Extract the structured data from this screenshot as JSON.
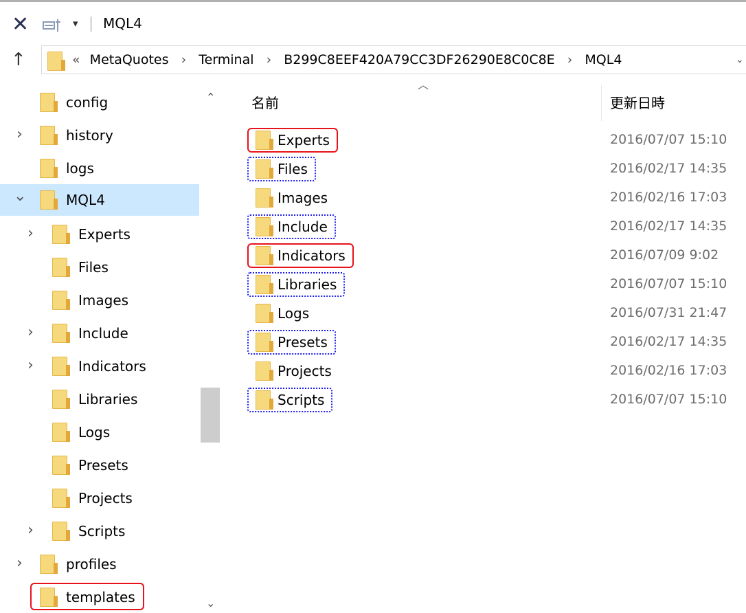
{
  "title_bar": {
    "close_glyph": "✕",
    "properties_icon": "properties-icon",
    "dropdown_glyph": "▾",
    "title": "MQL4"
  },
  "address_bar": {
    "up_glyph": "↑",
    "overflow": "«",
    "separator": "›",
    "crumbs": [
      "MetaQuotes",
      "Terminal",
      "B299C8EEF420A79CC3DF26290E8C0C8E",
      "MQL4"
    ],
    "dropdown_glyph": "⌄"
  },
  "nav_pane": {
    "items": [
      {
        "label": "config",
        "expander": ""
      },
      {
        "label": "history",
        "expander": "›"
      },
      {
        "label": "logs",
        "expander": ""
      },
      {
        "label": "MQL4",
        "expander": "⌄"
      },
      {
        "label": "Experts",
        "expander": "›"
      },
      {
        "label": "Files",
        "expander": ""
      },
      {
        "label": "Images",
        "expander": ""
      },
      {
        "label": "Include",
        "expander": "›"
      },
      {
        "label": "Indicators",
        "expander": "›"
      },
      {
        "label": "Libraries",
        "expander": ""
      },
      {
        "label": "Logs",
        "expander": ""
      },
      {
        "label": "Presets",
        "expander": ""
      },
      {
        "label": "Projects",
        "expander": ""
      },
      {
        "label": "Scripts",
        "expander": "›"
      },
      {
        "label": "profiles",
        "expander": "›"
      },
      {
        "label": "templates",
        "expander": ""
      }
    ],
    "scroll_up": "⌃",
    "scroll_down": "⌄"
  },
  "content": {
    "sort_glyph": "︿",
    "columns": {
      "name": "名前",
      "date": "更新日時"
    },
    "rows": [
      {
        "name": "Experts",
        "date": "2016/07/07 15:10",
        "highlight": "red"
      },
      {
        "name": "Files",
        "date": "2016/02/17 14:35",
        "highlight": "blue"
      },
      {
        "name": "Images",
        "date": "2016/02/16 17:03",
        "highlight": "none"
      },
      {
        "name": "Include",
        "date": "2016/02/17 14:35",
        "highlight": "blue"
      },
      {
        "name": "Indicators",
        "date": "2016/07/09 9:02",
        "highlight": "red"
      },
      {
        "name": "Libraries",
        "date": "2016/07/07 15:10",
        "highlight": "blue"
      },
      {
        "name": "Logs",
        "date": "2016/07/31 21:47",
        "highlight": "none"
      },
      {
        "name": "Presets",
        "date": "2016/02/17 14:35",
        "highlight": "blue"
      },
      {
        "name": "Projects",
        "date": "2016/02/16 17:03",
        "highlight": "none"
      },
      {
        "name": "Scripts",
        "date": "2016/07/07 15:10",
        "highlight": "blue"
      }
    ]
  },
  "colors": {
    "selection": "#cce8ff",
    "red_highlight": "#e8121b",
    "blue_highlight": "#1d1df0",
    "folder": "#f6d87d"
  }
}
